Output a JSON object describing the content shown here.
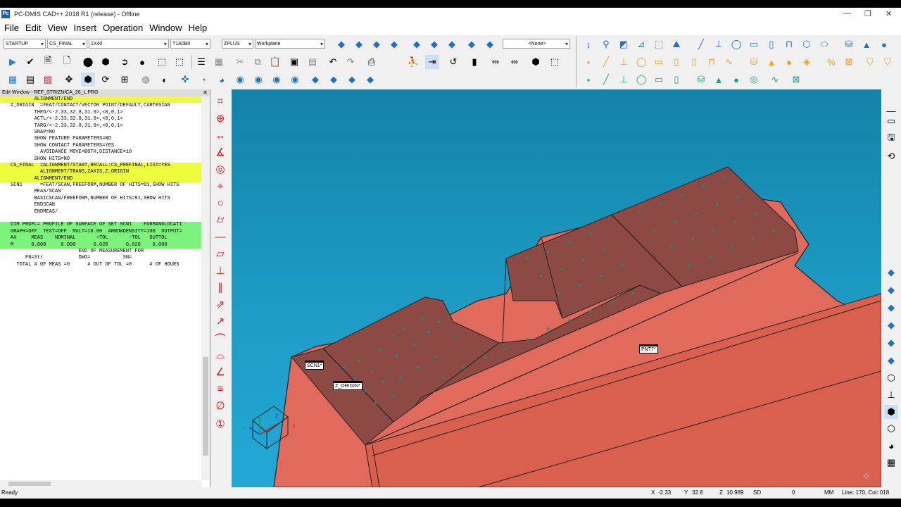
{
  "window": {
    "title": "PC-DMIS CAD++ 2018 R1 (release) - Offline",
    "app_icon": "Pc"
  },
  "menu": [
    "File",
    "Edit",
    "View",
    "Insert",
    "Operation",
    "Window",
    "Help"
  ],
  "toolbar": {
    "startup": "STARTUP",
    "alignment": "CS_FINAL",
    "probe_tip": "1X40",
    "tip_angle": "T1A0B0",
    "workplane_dir": "ZPLUS",
    "workplane": "Workplane",
    "none_select": "<None>"
  },
  "edit_window": {
    "title": "Edit Window - REF_STRIZNICA_26_L.PRG",
    "lines": [
      {
        "text": "        ALIGNMENT/END",
        "hl": "y"
      },
      {
        "text": "Z_ORIGIN  =FEAT/CONTACT/VECTOR POINT/DEFAULT,CARTESIAN",
        "hl": ""
      },
      {
        "text": "        THEO/<-2.33,32.8,31.9>,<0,0,1>",
        "hl": ""
      },
      {
        "text": "        ACTL/<-2.33,32.8,31.9>,<0,0,1>",
        "hl": ""
      },
      {
        "text": "        TARG/<-2.33,32.8,31.9>,<0,0,1>",
        "hl": ""
      },
      {
        "text": "        SNAP=NO",
        "hl": ""
      },
      {
        "text": "        SHOW FEATURE PARAMETERS=NO",
        "hl": ""
      },
      {
        "text": "        SHOW CONTACT PARAMETERS=YES",
        "hl": ""
      },
      {
        "text": "          AVOIDANCE MOVE=BOTH,DISTANCE=10",
        "hl": ""
      },
      {
        "text": "        SHOW HITS=NO",
        "hl": ""
      },
      {
        "text": "CS_FINAL  =ALIGNMENT/START,RECALL:CS_PREFINAL,LIST=YES",
        "hl": "y"
      },
      {
        "text": "          ALIGNMENT/TRANS,ZAXIS,Z_ORIGIN",
        "hl": "y"
      },
      {
        "text": "        ALIGNMENT/END",
        "hl": "y"
      },
      {
        "text": "SCN1      =FEAT/SCAN,FREEFORM,NUMBER OF HITS=91,SHOW HITS",
        "hl": ""
      },
      {
        "text": "        MEAS/SCAN",
        "hl": ""
      },
      {
        "text": "        BASICSCAN/FREEFORM,NUMBER OF HITS=91,SHOW HITS",
        "hl": ""
      },
      {
        "text": "        ENDSCAN",
        "hl": ""
      },
      {
        "text": "        ENDMEAS/",
        "hl": ""
      },
      {
        "text": "",
        "hl": ""
      },
      {
        "text": "DIM PROFL= PROFILE OF SURFACE OF SET SCN1    FORMANDLOCATI",
        "hl": "g"
      },
      {
        "text": "GRAPH=OFF  TEXT=OFF  MULT=10.00  ARROWDENSITY=100  OUTPUT=",
        "hl": "g"
      },
      {
        "text": "AX     MEAS    NOMINAL       +TOL       -TOL   OUTTOL",
        "hl": "g"
      },
      {
        "text": "M      0.000     0.000      0.020      0.020    0.000",
        "hl": "g"
      },
      {
        "text": "                       END OF MEASUREMENT FOR",
        "hl": ""
      },
      {
        "text": "     PN=Str            DWG=           SN=",
        "hl": ""
      },
      {
        "text": "  TOTAL # OF MEAS =0      # OUT OF TOL =0      # OF HOURS",
        "hl": ""
      }
    ]
  },
  "viewport": {
    "labels": {
      "scn": "SCN1*",
      "zorigin": "Z_ORIGIN*",
      "pnt": "PNT7*"
    },
    "part_color": "#e06a5c",
    "scan_color": "#8d4944",
    "background": "#1c9ac3",
    "triad": {
      "x": "X",
      "y": "Y",
      "z": "Z"
    }
  },
  "status": {
    "ready": "Ready",
    "x_label": "X",
    "x": "-2.33",
    "y_label": "Y",
    "y": "32.8",
    "z_label": "Z",
    "z": "10.989",
    "sd_label": "SD",
    "sd": "0",
    "units": "MM",
    "linecol": "Line: 170, Col: 018"
  }
}
